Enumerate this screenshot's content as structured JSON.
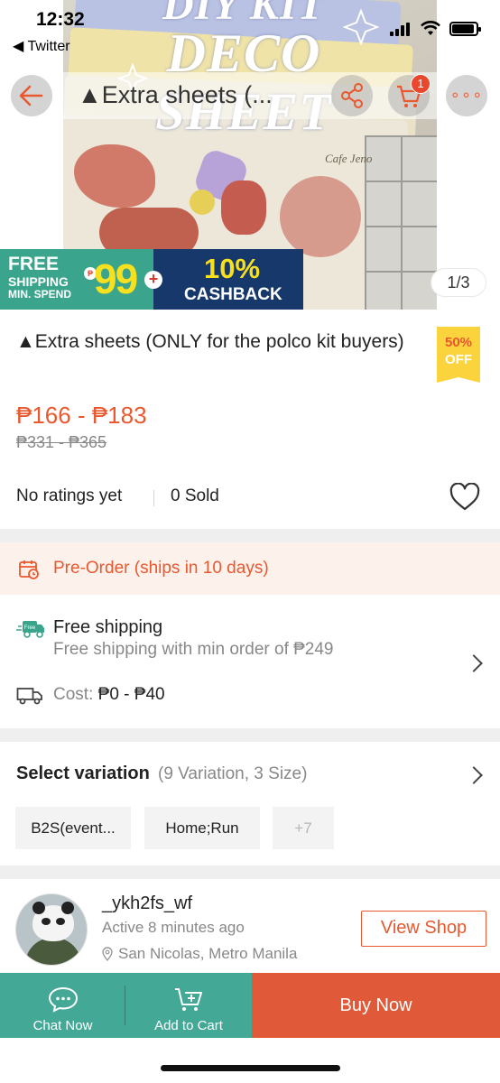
{
  "status_bar": {
    "time": "12:32",
    "back_app": "◀ Twitter"
  },
  "hero": {
    "image_text": [
      "DIY KIT",
      "DECO",
      "SHEET"
    ],
    "brand_text": "Cafe Jeno",
    "pager": "1/3"
  },
  "promo": {
    "free": "FREE",
    "shipping": "SHIPPING",
    "min_spend": "MIN. SPEND",
    "peso_sign": "₱",
    "amount": "99",
    "plus": "+",
    "cashback_pct": "10%",
    "cashback": "CASHBACK"
  },
  "nav": {
    "title": "▲Extra sheets (...",
    "cart_count": "1",
    "more": "∘∘∘"
  },
  "product": {
    "name": "▲Extra sheets (ONLY for the polco kit buyers)",
    "discount_pct": "50%",
    "discount_off": "OFF",
    "price": "₱166 - ₱183",
    "original_price": "₱331 - ₱365",
    "ratings": "No ratings yet",
    "sold": "0 Sold"
  },
  "preorder": {
    "text": "Pre-Order (ships in 10 days)"
  },
  "shipping": {
    "icon_label": "Free",
    "title": "Free shipping",
    "subtitle": "Free shipping with min order of ₱249",
    "cost_label": "Cost:",
    "cost_value": "₱0 - ₱40"
  },
  "variation": {
    "title": "Select variation",
    "summary": "(9 Variation, 3 Size)",
    "options": [
      "B2S(event...",
      "Home;Run",
      "+7"
    ]
  },
  "shop": {
    "name": "_ykh2fs_wf",
    "active": "Active 8 minutes ago",
    "location": "San Nicolas, Metro Manila",
    "view_label": "View Shop"
  },
  "bottom_bar": {
    "chat": "Chat Now",
    "add_to_cart": "Add to Cart",
    "buy_now": "Buy Now"
  },
  "colors": {
    "accent": "#e9582e",
    "teal": "#44a897",
    "promo_navy": "#17386b",
    "badge_yellow": "#fbd33d"
  }
}
